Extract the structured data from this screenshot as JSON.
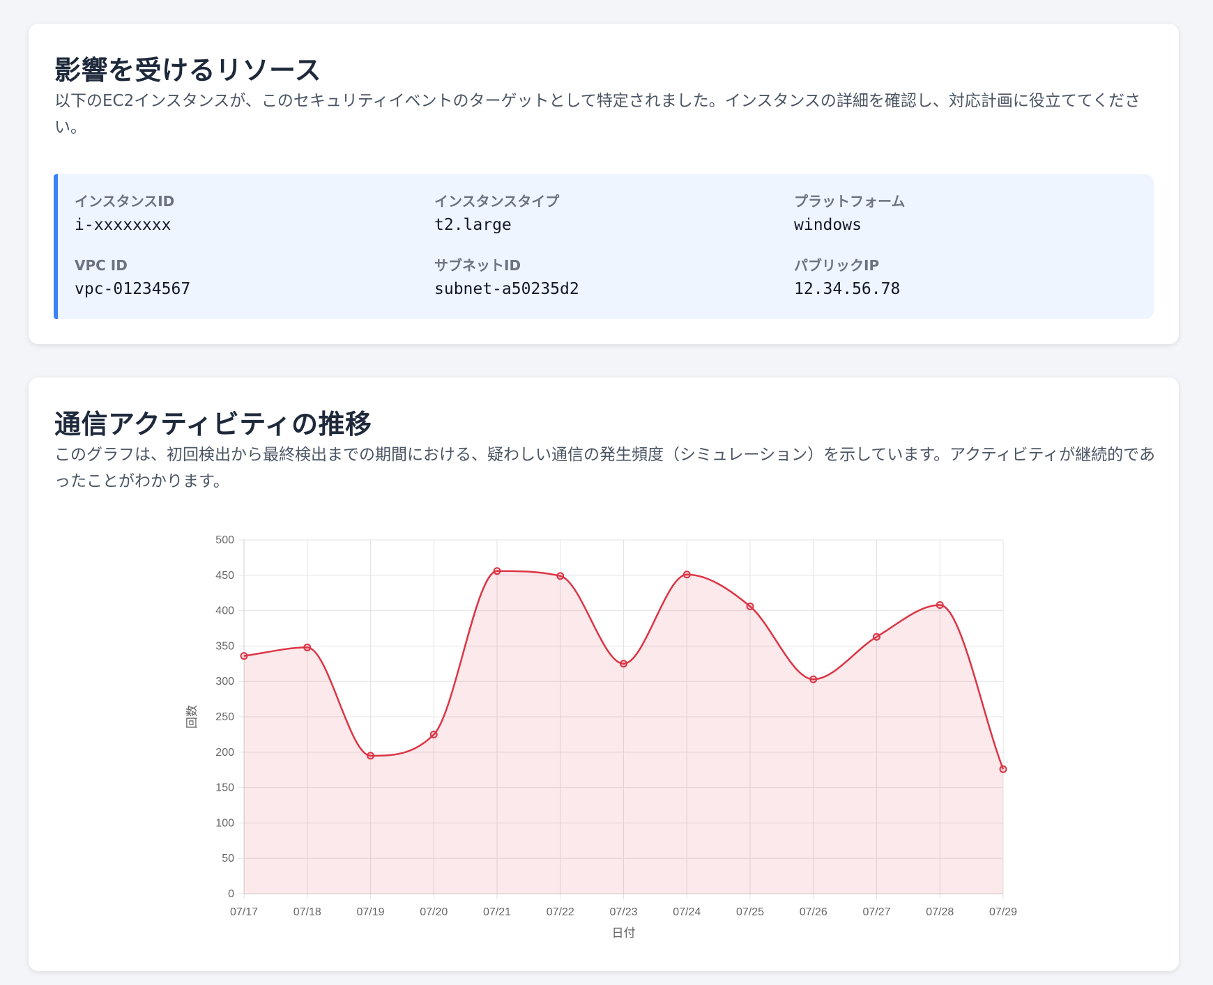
{
  "resources": {
    "title": "影響を受けるリソース",
    "description": "以下のEC2インスタンスが、このセキュリティイベントのターゲットとして特定されました。インスタンスの詳細を確認し、対応計画に役立ててください。",
    "accent_color": "#3b82f6",
    "fields": [
      {
        "label": "インスタンスID",
        "value": "i-xxxxxxxx"
      },
      {
        "label": "インスタンスタイプ",
        "value": "t2.large"
      },
      {
        "label": "プラットフォーム",
        "value": "windows"
      },
      {
        "label": "VPC ID",
        "value": "vpc-01234567"
      },
      {
        "label": "サブネットID",
        "value": "subnet-a50235d2"
      },
      {
        "label": "パブリックIP",
        "value": "12.34.56.78"
      }
    ]
  },
  "activity": {
    "title": "通信アクティビティの推移",
    "description": "このグラフは、初回検出から最終検出までの期間における、疑わしい通信の発生頻度（シミュレーション）を示しています。アクティビティが継続的であったことがわかります。"
  },
  "chart_data": {
    "type": "line",
    "categories": [
      "07/17",
      "07/18",
      "07/19",
      "07/20",
      "07/21",
      "07/22",
      "07/23",
      "07/24",
      "07/25",
      "07/26",
      "07/27",
      "07/28",
      "07/29"
    ],
    "series": [
      {
        "values": [
          336,
          348,
          195,
          225,
          456,
          449,
          325,
          451,
          406,
          303,
          363,
          408,
          176
        ],
        "color": "#dc3545"
      }
    ],
    "xlabel": "日付",
    "ylabel": "回数",
    "ylim": [
      0,
      500
    ],
    "yticks": [
      0,
      50,
      100,
      150,
      200,
      250,
      300,
      350,
      400,
      450,
      500
    ],
    "grid": true,
    "fill": true,
    "curve": "smooth"
  }
}
